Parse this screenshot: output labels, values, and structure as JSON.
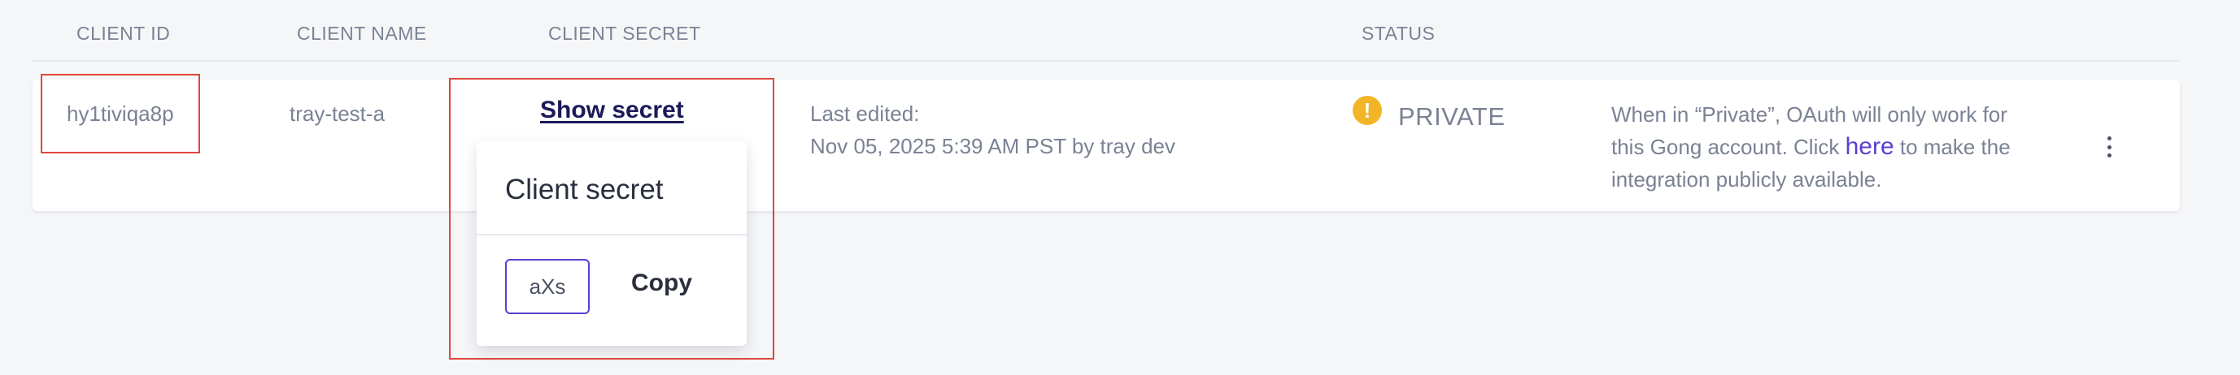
{
  "table": {
    "headers": {
      "client_id": "CLIENT ID",
      "client_name": "CLIENT NAME",
      "client_secret": "CLIENT SECRET",
      "status": "STATUS"
    },
    "rows": [
      {
        "client_id": "hy1tiviqa8p",
        "client_name": "tray-test-a",
        "show_secret_label": "Show secret",
        "edited_label": "Last edited:",
        "edited_value": "Nov 05, 2025 5:39 AM PST by tray dev",
        "status": "PRIVATE",
        "status_icon": "warning-icon",
        "description_before": "When in “Private”, OAuth will only work for this Gong account. Click ",
        "description_link": "here",
        "description_after": " to make the integration publicly available."
      }
    ]
  },
  "popover": {
    "title": "Client secret",
    "secret_value": "aXs",
    "copy_label": "Copy"
  },
  "colors": {
    "accent": "#5b3fd0",
    "highlight": "#e0463a",
    "warning": "#f2b527"
  }
}
